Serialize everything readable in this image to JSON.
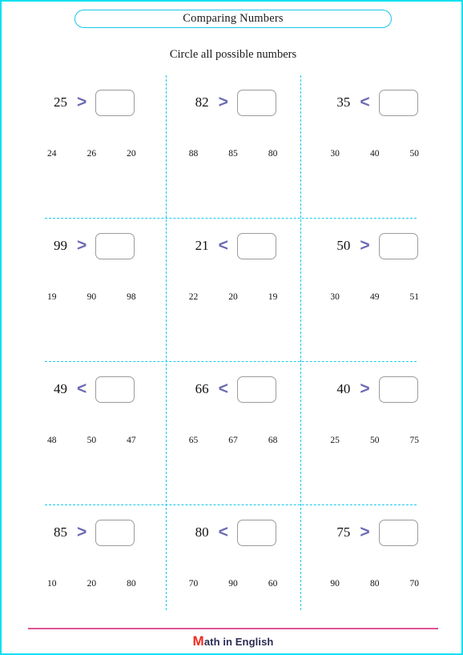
{
  "page": {
    "border_color": "#0ce1f0",
    "background": "#ffffff"
  },
  "header": {
    "title": "Comparing Numbers",
    "title_border_color": "#18c8e8",
    "instruction": "Circle all possible numbers"
  },
  "grid": {
    "separator_color": "#19c9ef",
    "operator_color": "#6a6ab4",
    "answer_box_border_color": "#9b9b9b",
    "rows": [
      {
        "cells": [
          {
            "number": "25",
            "operator": ">",
            "answer": "",
            "options": [
              "24",
              "26",
              "20"
            ]
          },
          {
            "number": "82",
            "operator": ">",
            "answer": "",
            "options": [
              "88",
              "85",
              "80"
            ]
          },
          {
            "number": "35",
            "operator": "<",
            "answer": "",
            "options": [
              "30",
              "40",
              "50"
            ]
          }
        ]
      },
      {
        "cells": [
          {
            "number": "99",
            "operator": ">",
            "answer": "",
            "options": [
              "19",
              "90",
              "98"
            ]
          },
          {
            "number": "21",
            "operator": "<",
            "answer": "",
            "options": [
              "22",
              "20",
              "19"
            ]
          },
          {
            "number": "50",
            "operator": ">",
            "answer": "",
            "options": [
              "30",
              "49",
              "51"
            ]
          }
        ]
      },
      {
        "cells": [
          {
            "number": "49",
            "operator": "<",
            "answer": "",
            "options": [
              "48",
              "50",
              "47"
            ]
          },
          {
            "number": "66",
            "operator": "<",
            "answer": "",
            "options": [
              "65",
              "67",
              "68"
            ]
          },
          {
            "number": "40",
            "operator": ">",
            "answer": "",
            "options": [
              "25",
              "50",
              "75"
            ]
          }
        ]
      },
      {
        "cells": [
          {
            "number": "85",
            "operator": ">",
            "answer": "",
            "options": [
              "10",
              "20",
              "80"
            ]
          },
          {
            "number": "80",
            "operator": "<",
            "answer": "",
            "options": [
              "70",
              "90",
              "60"
            ]
          },
          {
            "number": "75",
            "operator": ">",
            "answer": "",
            "options": [
              "90",
              "80",
              "70"
            ]
          }
        ]
      }
    ]
  },
  "footer": {
    "rule_color": "#dd5593",
    "logo_initial": "M",
    "logo_rest": "ath in English",
    "logo_initial_color": "#ef2b20",
    "logo_text_color": "#2b2b52"
  }
}
